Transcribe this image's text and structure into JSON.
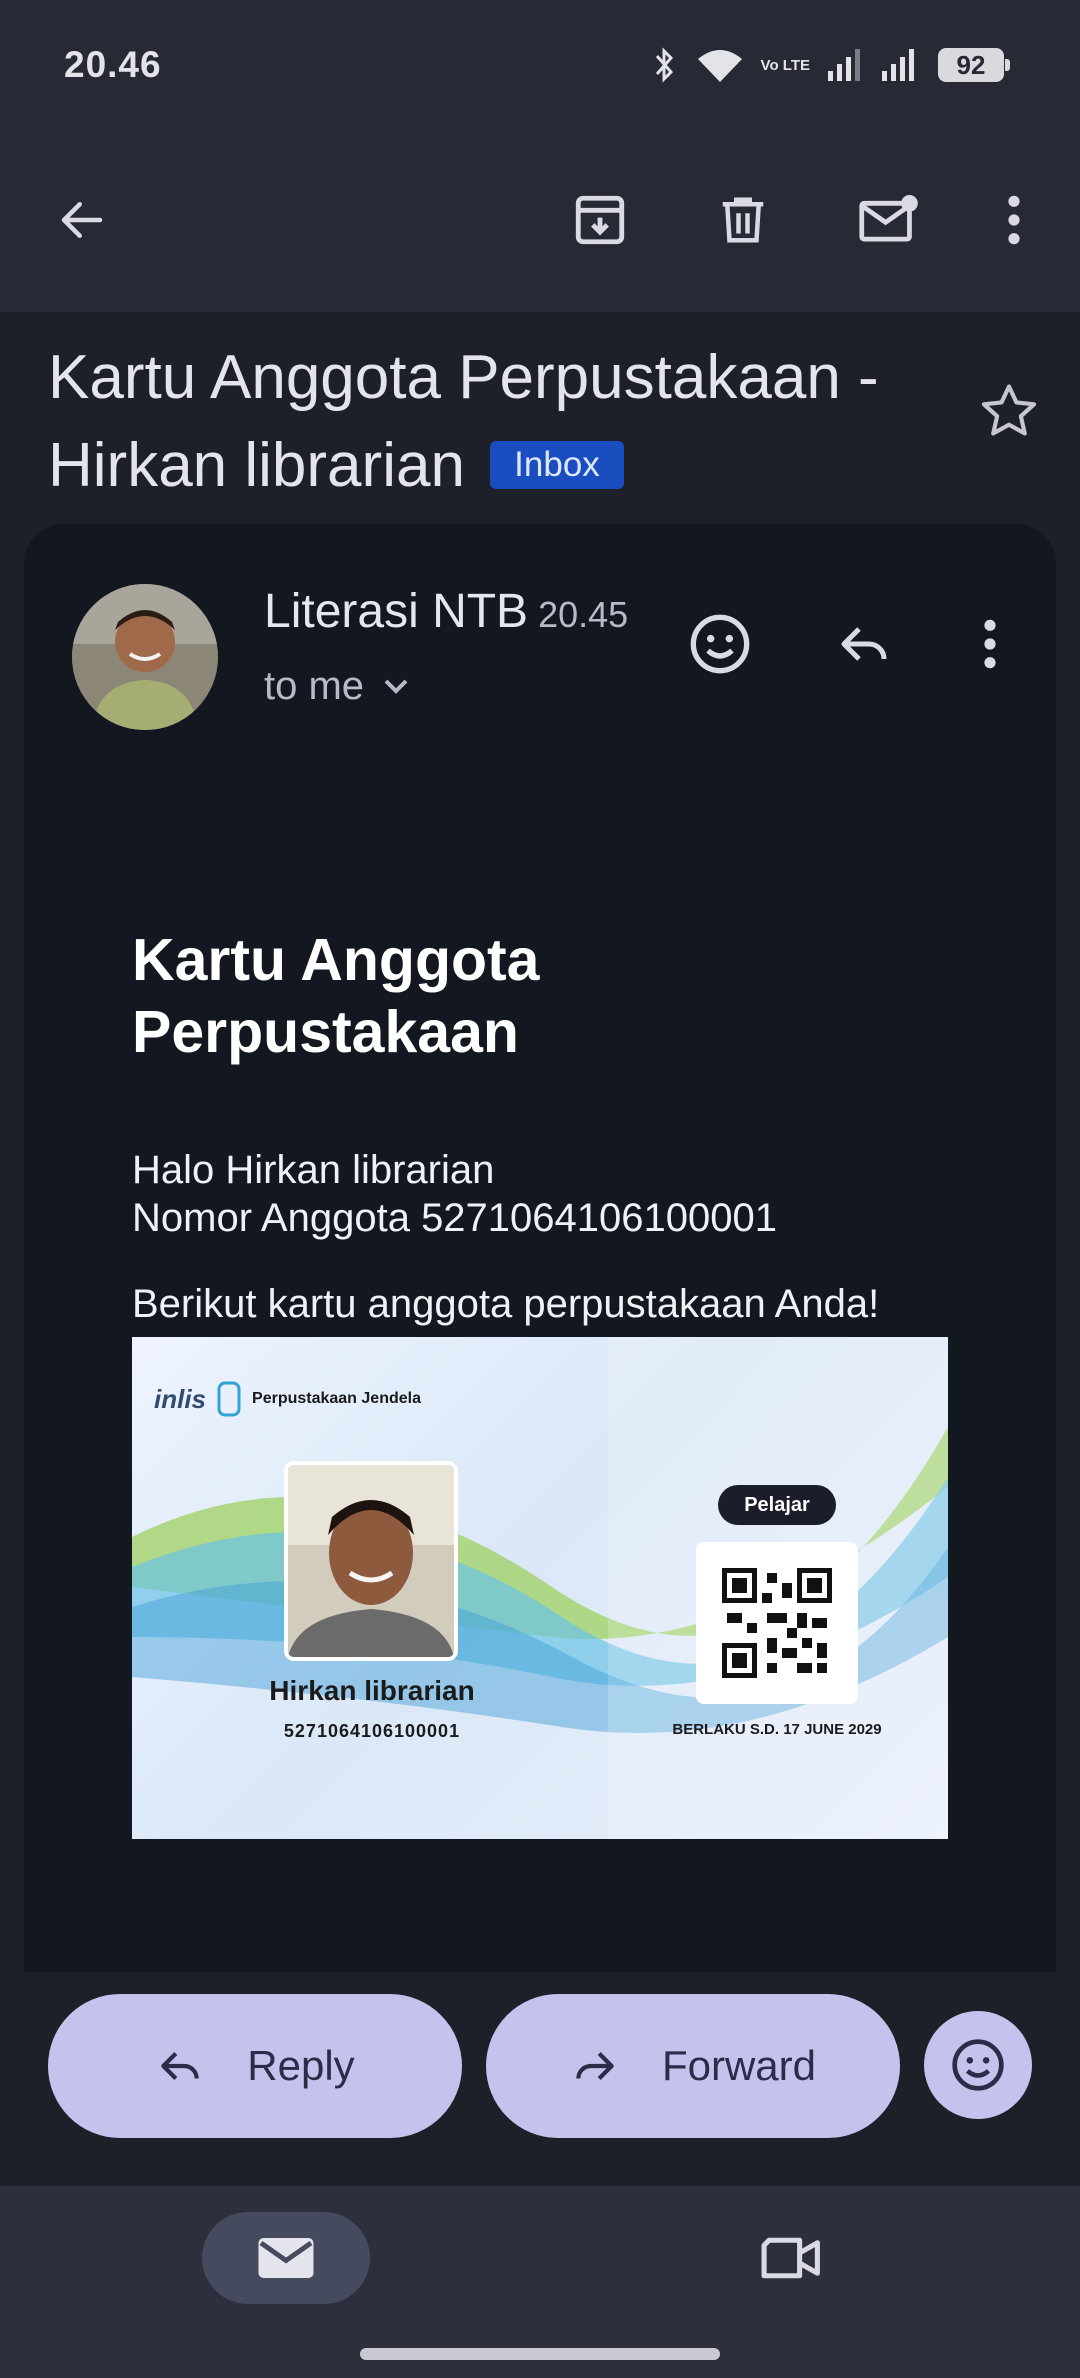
{
  "status_bar": {
    "time": "20.46",
    "battery": "92",
    "volte": "Vo LTE"
  },
  "toolbar": {
    "back_icon": "arrow-left-icon",
    "archive_icon": "archive-icon",
    "delete_icon": "trash-icon",
    "mark_unread_icon": "mail-unread-icon",
    "more_icon": "more-vert-icon"
  },
  "email": {
    "subject": "Kartu Anggota Perpustakaan - Hirkan librarian",
    "label": "Inbox",
    "sender": "Literasi NTB",
    "time": "20.45",
    "recipient": "to me",
    "body": {
      "title": "Kartu Anggota Perpustakaan",
      "greeting": "Halo Hirkan librarian",
      "member_number_line": "Nomor Anggota 5271064106100001",
      "intro": "Berikut kartu anggota perpustakaan Anda!"
    },
    "card_image": {
      "logo": "inlis",
      "library": "Perpustakaan Jendela",
      "member_name": "Hirkan librarian",
      "member_number": "5271064106100001",
      "category": "Pelajar",
      "valid_until": "BERLAKU S.D. 17 JUNE 2029"
    }
  },
  "actions": {
    "reply": "Reply",
    "forward": "Forward"
  },
  "colors": {
    "accent_pill": "#c4c3ee",
    "inbox_chip": "#1a4ec0",
    "background": "#272a35"
  }
}
